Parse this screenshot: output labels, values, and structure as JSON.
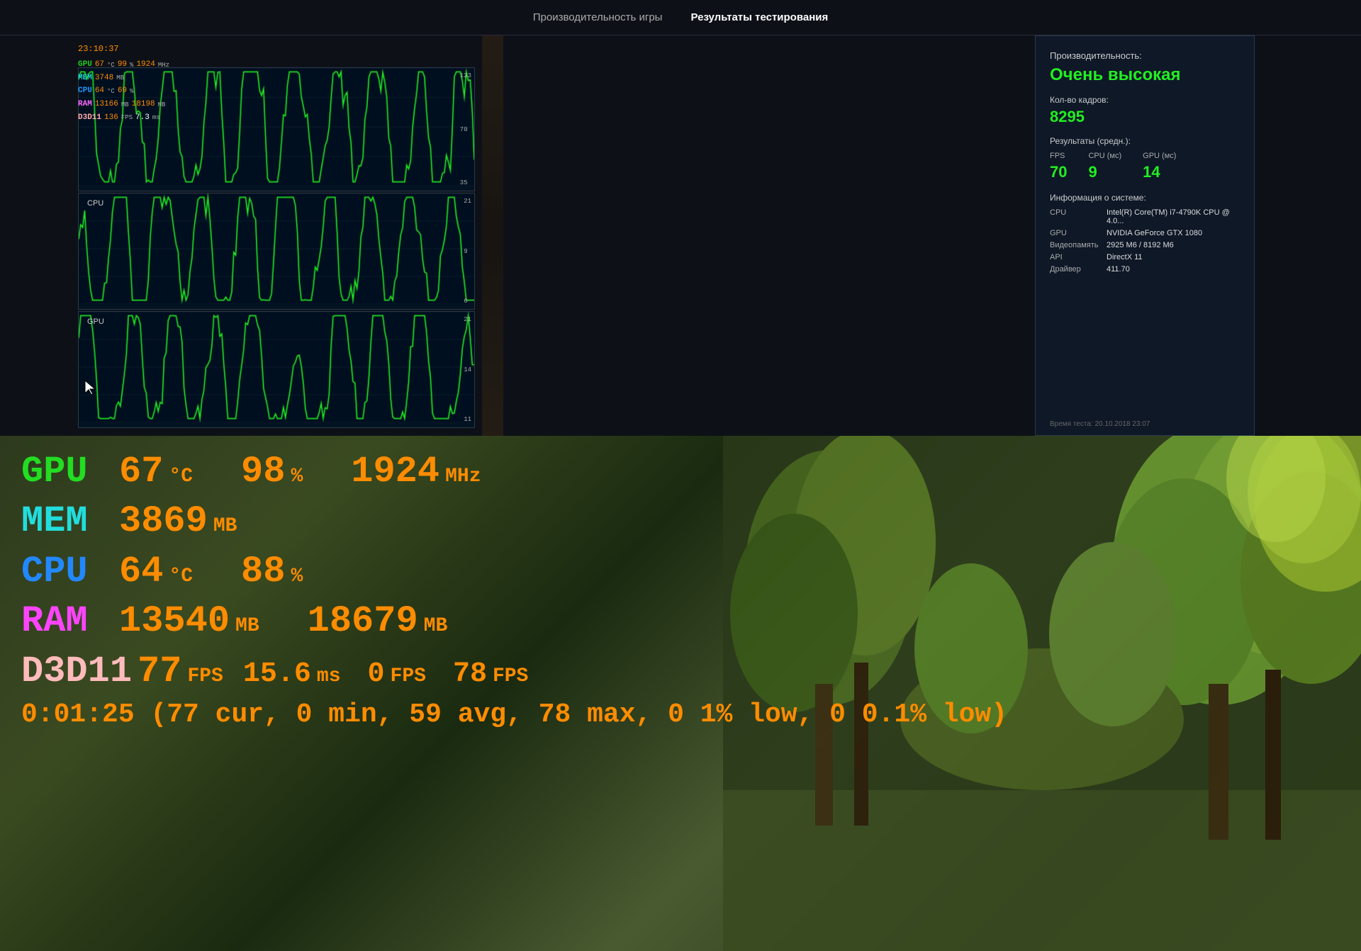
{
  "nav": {
    "tab1": "Производительность игры",
    "tab2": "Результаты тестирования"
  },
  "statsOverlay": {
    "time": "23:10:37",
    "gpu": {
      "label": "GPU",
      "temp": "67",
      "tempUnit": "°C",
      "load": "99",
      "loadUnit": "%",
      "clock": "1924",
      "clockUnit": "MHz"
    },
    "mem": {
      "label": "MEM",
      "val": "3748",
      "unit": "MB"
    },
    "cpu": {
      "label": "CPU",
      "temp": "64",
      "tempUnit": "°C",
      "load": "69",
      "loadUnit": "%"
    },
    "ram": {
      "label": "RAM",
      "val1": "13166",
      "unit1": "MB",
      "val2": "18198",
      "unit2": "MB"
    },
    "d3d": {
      "label": "D3D11",
      "fps": "136",
      "fpsUnit": "FPS",
      "ms": "7.3",
      "msUnit": "ms"
    }
  },
  "charts": {
    "fps": {
      "label": "",
      "yMax": "123",
      "yMid": "70",
      "yMin": "35"
    },
    "cpu": {
      "label": "CPU",
      "yMax": "21",
      "yMid": "9",
      "yMin": "6"
    },
    "gpu": {
      "label": "GPU",
      "yMax": "21",
      "yMid": "14",
      "yMin": "11"
    }
  },
  "results": {
    "perfLabel": "Производительность:",
    "perfValue": "Очень высокая",
    "framesLabel": "Кол-во кадров:",
    "framesValue": "8295",
    "avgLabel": "Результаты (средн.):",
    "statsHeaders": [
      "FPS",
      "CPU (мс)",
      "GPU (мс)"
    ],
    "statsValues": [
      "70",
      "9",
      "14"
    ],
    "sysinfoLabel": "Информация о системе:",
    "sysinfo": [
      {
        "key": "CPU",
        "val": "Intel(R) Core(TM) i7-4790K CPU @ 4.0..."
      },
      {
        "key": "GPU",
        "val": "NVIDIA GeForce GTX 1080"
      },
      {
        "key": "Видеопамять",
        "val": "2925 М6 / 8192 М6"
      },
      {
        "key": "API",
        "val": "DirectX 11"
      },
      {
        "key": "Драйвер",
        "val": "411.70"
      }
    ],
    "timestamp": "Время теста: 20.10.2018 23:07"
  },
  "hud": {
    "gpu": {
      "label": "GPU",
      "temp": "67",
      "tempUnit": "°C",
      "load": "98",
      "loadUnit": "%",
      "clock": "1924",
      "clockUnit": "MHz"
    },
    "mem": {
      "label": "MEM",
      "val": "3869",
      "unit": "MB"
    },
    "cpu": {
      "label": "CPU",
      "temp": "64",
      "tempUnit": "°C",
      "load": "88",
      "loadUnit": "%"
    },
    "ram": {
      "label": "RAM",
      "val1": "13540",
      "unit1": "MB",
      "val2": "18679",
      "unit2": "MB"
    },
    "d3d": {
      "label": "D3D11",
      "fps": "77",
      "fpsUnit": "FPS",
      "ms": "15.6",
      "msUnit": "ms",
      "fps0": "0",
      "fps0Unit": "FPS",
      "fps78": "78",
      "fps78Unit": "FPS"
    },
    "summary": "0:01:25 (77 cur,  0 min,  59 avg,  78 max,  0 1% low,  0 0.1% low)"
  }
}
